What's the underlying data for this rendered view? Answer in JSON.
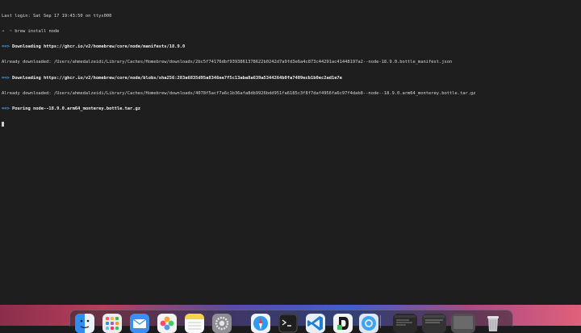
{
  "terminal": {
    "lines": [
      {
        "text": "Last login: Sat Sep 17 19:43:50 on ttys000"
      },
      {
        "prompt": "➜",
        "cwd": "~",
        "command": "brew install node"
      },
      {
        "marker": "==>",
        "text": "Downloading https://ghcr.io/v2/homebrew/core/node/manifests/18.9.0"
      },
      {
        "text": "Already downloaded: /Users/ahmedalzeidi/Library/Caches/Homebrew/downloads/2bc5f74176dbf9393861378622b0242d7a9fd3e6a4c873c44291ac41448197a2--node-18.9.0.bottle_manifest.json"
      },
      {
        "marker": "==>",
        "text": "Downloading https://ghcr.io/v2/homebrew/core/node/blobs/sha256:283a6835d95a8346ee7f5c13aba8a639a5344264b0fa7409ecb1b0ec2ad1e7e"
      },
      {
        "text": "Already downloaded: /Users/ahmedalzeidi/Library/Caches/Homebrew/downloads/4078f5acf7a6c1b36afa8db9926bdd951fa6185c3f8f7daf4956fa6c97f4dab8--node--18.9.0.arm64_monterey.bottle.tar.gz"
      },
      {
        "marker": "==>",
        "text": "Pouring node--18.9.0.arm64_monterey.bottle.tar.gz"
      }
    ]
  },
  "dock": {
    "apps": [
      {
        "name": "finder-icon",
        "color": "#2f8cf0"
      },
      {
        "name": "launchpad-icon",
        "color": "#e8e8ee"
      },
      {
        "name": "mail-icon",
        "color": "#3b8ff3"
      },
      {
        "name": "photos-icon",
        "color": "#f4f4f4"
      },
      {
        "name": "notes-icon",
        "color": "#f7d34a"
      },
      {
        "name": "system-settings-icon",
        "color": "#8e8e93"
      },
      {
        "name": "safari-icon",
        "color": "#2f9bf0"
      },
      {
        "name": "terminal-icon",
        "color": "#1f1f1f"
      },
      {
        "name": "vscode-icon",
        "color": "#1e7fd4"
      },
      {
        "name": "document-app-icon",
        "color": "#f2f2f2"
      },
      {
        "name": "browser-icon",
        "color": "#3fa4ee"
      },
      {
        "name": "window-thumbnail-icon",
        "color": "#2a2a2a"
      },
      {
        "name": "window-thumbnail-icon",
        "color": "#333333"
      },
      {
        "name": "window-thumbnail-icon",
        "color": "#505050"
      },
      {
        "name": "trash-icon",
        "color": "#d0d0d4"
      }
    ]
  }
}
